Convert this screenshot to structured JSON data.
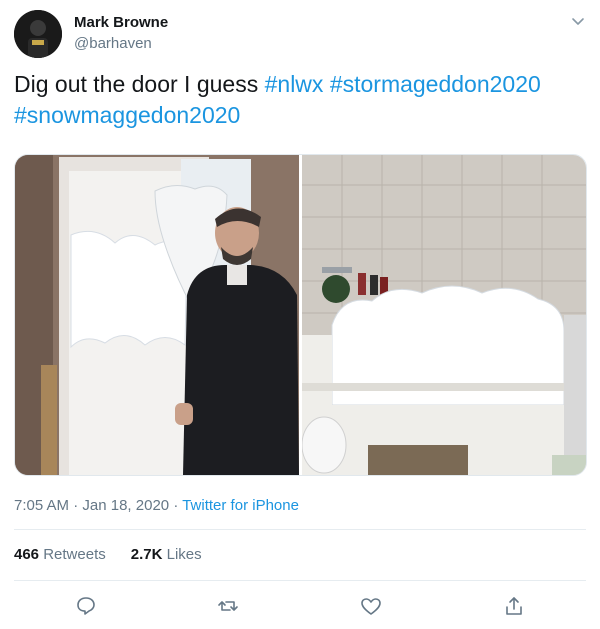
{
  "user": {
    "name": "Mark Browne",
    "handle": "@barhaven"
  },
  "tweet": {
    "text_plain": "Dig out the door I guess ",
    "hashtags": [
      "#nlwx",
      "#stormageddon2020",
      "#snowmaggedon2020"
    ]
  },
  "media": {
    "images": [
      "snow-door-photo",
      "snow-bathtub-photo"
    ]
  },
  "meta": {
    "time": "7:05 AM",
    "separator": "·",
    "date": "Jan 18, 2020",
    "source": "Twitter for iPhone"
  },
  "stats": {
    "retweets_count": "466",
    "retweets_label": "Retweets",
    "likes_count": "2.7K",
    "likes_label": "Likes"
  },
  "colors": {
    "accent": "#1b95e0",
    "secondary_text": "#657786",
    "divider": "#e6ecf0"
  },
  "icons": [
    "chevron-down-icon",
    "reply-icon",
    "retweet-icon",
    "like-icon",
    "share-icon"
  ]
}
